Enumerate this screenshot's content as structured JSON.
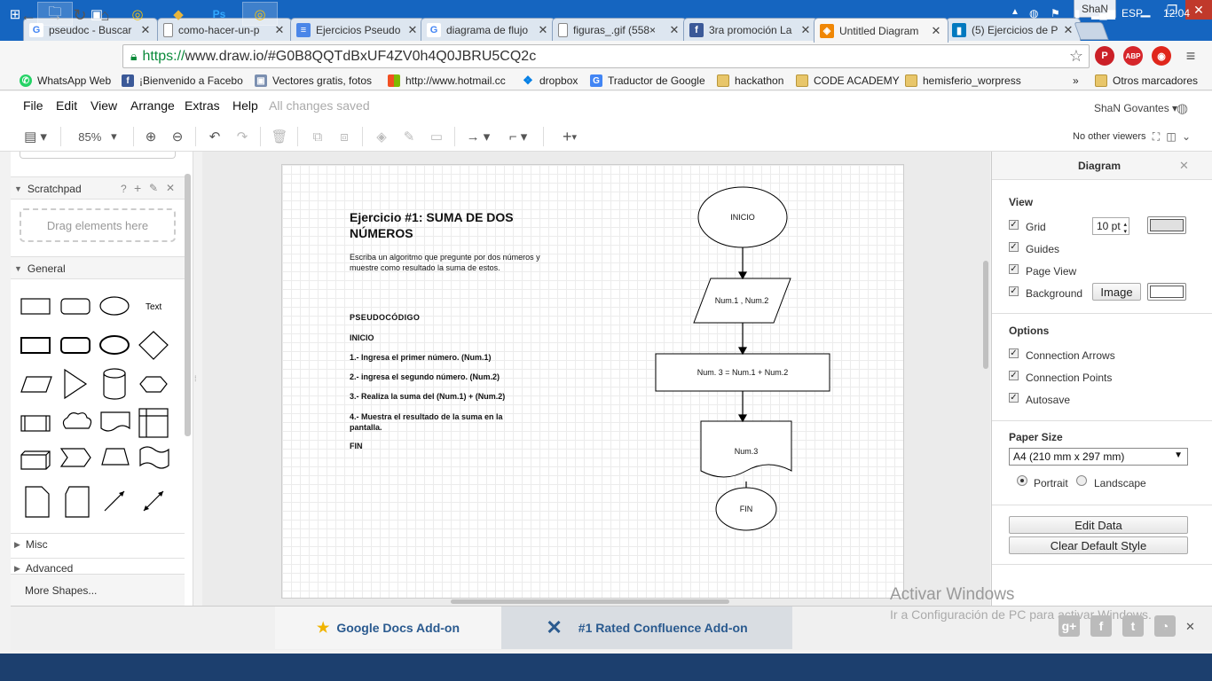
{
  "browser": {
    "profile": "ShaN",
    "tabs": [
      {
        "label": "pseudoc - Buscar",
        "icon": "google"
      },
      {
        "label": "como-hacer-un-p",
        "icon": "page"
      },
      {
        "label": "Ejercicios Pseudo",
        "icon": "docs"
      },
      {
        "label": "diagrama de flujo",
        "icon": "google"
      },
      {
        "label": "figuras_.gif (558×",
        "icon": "page"
      },
      {
        "label": "3ra promoción La",
        "icon": "facebook"
      },
      {
        "label": "Untitled Diagram",
        "icon": "drawio"
      },
      {
        "label": "(5) Ejercicios de P",
        "icon": "trello"
      }
    ],
    "url_scheme": "https://",
    "url_rest": "www.draw.io/#G0B8QQTdBxUF4ZV0h4Q0JBRU5CQ2c",
    "bookmarks": [
      "WhatsApp Web",
      "¡Bienvenido a Facebo",
      "Vectores gratis, fotos",
      "http://www.hotmail.cc",
      "dropbox",
      "Traductor de Google",
      "hackathon",
      "CODE ACADEMY",
      "hemisferio_worpress"
    ],
    "bookmarks_more": "»",
    "other_bookmarks": "Otros marcadores"
  },
  "app": {
    "menu": [
      "File",
      "Edit",
      "View",
      "Arrange",
      "Extras",
      "Help"
    ],
    "save_status": "All changes saved",
    "user": "ShaN Govantes",
    "zoom": "85%",
    "viewers": "No other viewers"
  },
  "sidebar": {
    "scratchpad": "Scratchpad",
    "scratchpad_help": "?",
    "drop_hint": "Drag elements here",
    "general": "General",
    "text_shape": "Text",
    "misc": "Misc",
    "advanced": "Advanced",
    "more_shapes": "More Shapes..."
  },
  "diagram": {
    "title": "Ejercicio #1: SUMA DE DOS NÚMEROS",
    "description": "Escriba un algoritmo que pregunte por dos números y muestre como resultado la suma de estos.",
    "pseudo_heading": "PSEUDOCÓDIGO",
    "pseudo_lines": [
      "INICIO",
      "1.- Ingresa el primer número. (Num.1)",
      "2.- ingresa el segundo número. (Num.2)",
      "3.- Realiza la suma del (Num.1) + (Num.2)",
      "4.- Muestra el resultado de la suma en la pantalla.",
      "FIN"
    ],
    "flow": {
      "start": "INICIO",
      "input": "Num.1 , Num.2",
      "process": "Num. 3 = Num.1 + Num.2",
      "output": "Num.3",
      "end": "FIN"
    }
  },
  "panel": {
    "title": "Diagram",
    "view": "View",
    "grid": "Grid",
    "grid_size": "10 pt",
    "guides": "Guides",
    "page_view": "Page View",
    "background": "Background",
    "image_btn": "Image",
    "options": "Options",
    "connection_arrows": "Connection Arrows",
    "connection_points": "Connection Points",
    "autosave": "Autosave",
    "paper_size": "Paper Size",
    "paper_value": "A4 (210 mm x 297 mm)",
    "portrait": "Portrait",
    "landscape": "Landscape",
    "edit_data": "Edit Data",
    "clear_style": "Clear Default Style"
  },
  "footer": {
    "gdocs": "Google Docs Add-on",
    "confluence": "#1 Rated Confluence Add-on"
  },
  "watermark": {
    "line1": "Activar Windows",
    "line2": "Ir a Configuración de PC para activar Windows."
  },
  "taskbar": {
    "lang": "ESP",
    "time": "12:04"
  },
  "colors": {
    "chrome_frame": "#1565c0",
    "taskbar": "#1c3f6e",
    "link_blue": "#2a5a8f"
  }
}
